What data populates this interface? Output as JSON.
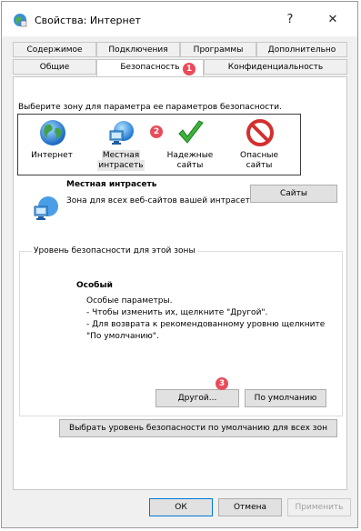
{
  "window": {
    "title": "Свойства: Интернет",
    "help_label": "?",
    "close_label": "✕"
  },
  "tabs": {
    "row1": [
      "Содержимое",
      "Подключения",
      "Программы",
      "Дополнительно"
    ],
    "row2": [
      "Общие",
      "Безопасность",
      "Конфиденциальность"
    ]
  },
  "zones": {
    "prompt": "Выберите зону для параметра ее параметров безопасности.",
    "items": [
      {
        "line1": "Интернет",
        "line2": "",
        "icon": "globe-icon"
      },
      {
        "line1": "Местная",
        "line2": "интрасеть",
        "icon": "intranet-icon"
      },
      {
        "line1": "Надежные",
        "line2": "сайты",
        "icon": "checkmark-icon"
      },
      {
        "line1": "Опасные",
        "line2": "сайты",
        "icon": "prohibited-icon"
      }
    ],
    "selected_title": "Местная интрасеть",
    "selected_desc": "Зона для всех веб-сайтов вашей интрасети.",
    "sites_button": "Сайты"
  },
  "security_level": {
    "group_title": "Уровень безопасности для этой зоны",
    "level_title": "Особый",
    "level_desc": "Особые параметры.\n- Чтобы изменить их, щелкните \"Другой\".\n- Для возврата к рекомендованному уровню щелкните\n\"По умолчанию\".",
    "custom_button": "Другой...",
    "default_button": "По умолчанию",
    "reset_all_button": "Выбрать уровень безопасности по умолчанию для всех зон"
  },
  "footer": {
    "ok": "ОК",
    "cancel": "Отмена",
    "apply": "Применить"
  },
  "badges": {
    "b1": "1",
    "b2": "2",
    "b3": "3"
  },
  "colors": {
    "badge": "#e84c5a",
    "accent": "#0078d7"
  }
}
